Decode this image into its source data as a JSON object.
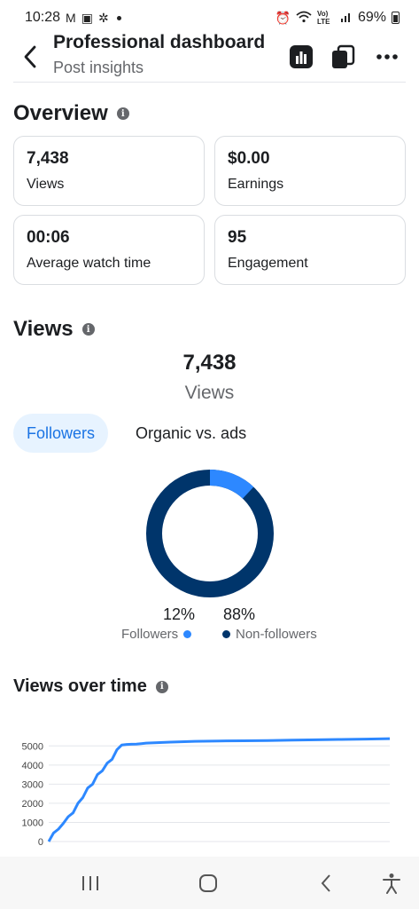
{
  "status_bar": {
    "time": "10:28",
    "battery": "69%",
    "net_label": "Vo) LTE"
  },
  "header": {
    "title": "Professional dashboard",
    "subtitle": "Post insights"
  },
  "overview": {
    "title": "Overview",
    "cards": [
      {
        "value": "7,438",
        "label": "Views"
      },
      {
        "value": "$0.00",
        "label": "Earnings"
      },
      {
        "value": "00:06",
        "label": "Average watch time"
      },
      {
        "value": "95",
        "label": "Engagement"
      }
    ]
  },
  "views": {
    "title": "Views",
    "total": "7,438",
    "total_label": "Views",
    "tabs": [
      "Followers",
      "Organic vs. ads"
    ],
    "followers_pct": "12%",
    "non_followers_pct": "88%",
    "legend_followers": "Followers",
    "legend_non_followers": "Non-followers",
    "followers_fraction": 0.12,
    "colors": {
      "followers": "#2d88ff",
      "non_followers": "#00356b"
    }
  },
  "views_over_time": {
    "title": "Views over time"
  },
  "chart_data": {
    "type": "line",
    "yticks": [
      0,
      1000,
      2000,
      3000,
      4000,
      5000
    ],
    "ylim": [
      0,
      5200
    ],
    "series": [
      {
        "color": "#2d88ff",
        "x": [
          0,
          1,
          2,
          3,
          4,
          5,
          6,
          7,
          8,
          9,
          10,
          11,
          12,
          13,
          14,
          15,
          16,
          17,
          18,
          19,
          20,
          25,
          30,
          35,
          40,
          45,
          50,
          55,
          60,
          65,
          70
        ],
        "y": [
          0,
          450,
          650,
          950,
          1300,
          1500,
          2000,
          2300,
          2800,
          3000,
          3500,
          3700,
          4100,
          4300,
          4800,
          5050,
          5080,
          5090,
          5100,
          5120,
          5150,
          5200,
          5240,
          5260,
          5270,
          5280,
          5300,
          5320,
          5340,
          5360,
          5380
        ]
      }
    ]
  }
}
